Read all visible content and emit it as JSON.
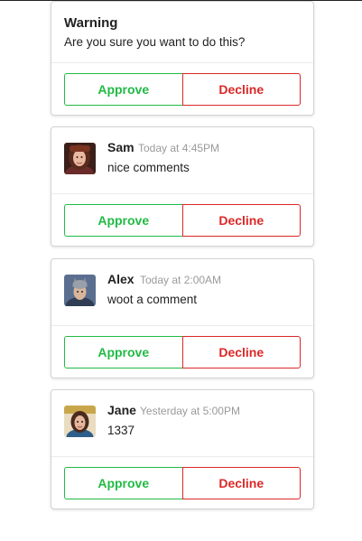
{
  "warning": {
    "title": "Warning",
    "description": "Are you sure you want to do this?",
    "approve_label": "Approve",
    "decline_label": "Decline"
  },
  "comments": [
    {
      "author": "Sam",
      "time": "Today at 4:45PM",
      "text": "nice comments",
      "avatar_icon": "avatar-sam",
      "approve_label": "Approve",
      "decline_label": "Decline"
    },
    {
      "author": "Alex",
      "time": "Today at 2:00AM",
      "text": "woot a comment",
      "avatar_icon": "avatar-alex",
      "approve_label": "Approve",
      "decline_label": "Decline"
    },
    {
      "author": "Jane",
      "time": "Yesterday at 5:00PM",
      "text": "1337",
      "avatar_icon": "avatar-jane",
      "approve_label": "Approve",
      "decline_label": "Decline"
    }
  ],
  "colors": {
    "approve": "#21ba45",
    "decline": "#db2828",
    "meta_text": "#9a9a9a",
    "card_border": "#d4d4d5"
  }
}
